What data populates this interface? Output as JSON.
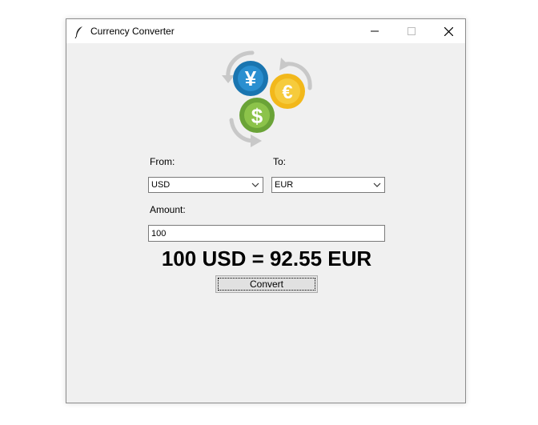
{
  "window": {
    "title": "Currency Converter"
  },
  "logo": {
    "symbols": {
      "yen": "¥",
      "euro": "€",
      "dollar": "$"
    },
    "colors": {
      "yen": "#1a75b0",
      "euro": "#f2b81b",
      "dollar": "#7cb342",
      "arrows": "#c8c8c8"
    }
  },
  "form": {
    "from_label": "From:",
    "to_label": "To:",
    "from_value": "USD",
    "to_value": "EUR",
    "amount_label": "Amount:",
    "amount_value": "100"
  },
  "result": {
    "text": "100 USD = 92.55 EUR"
  },
  "convert_button": {
    "label": "Convert"
  }
}
